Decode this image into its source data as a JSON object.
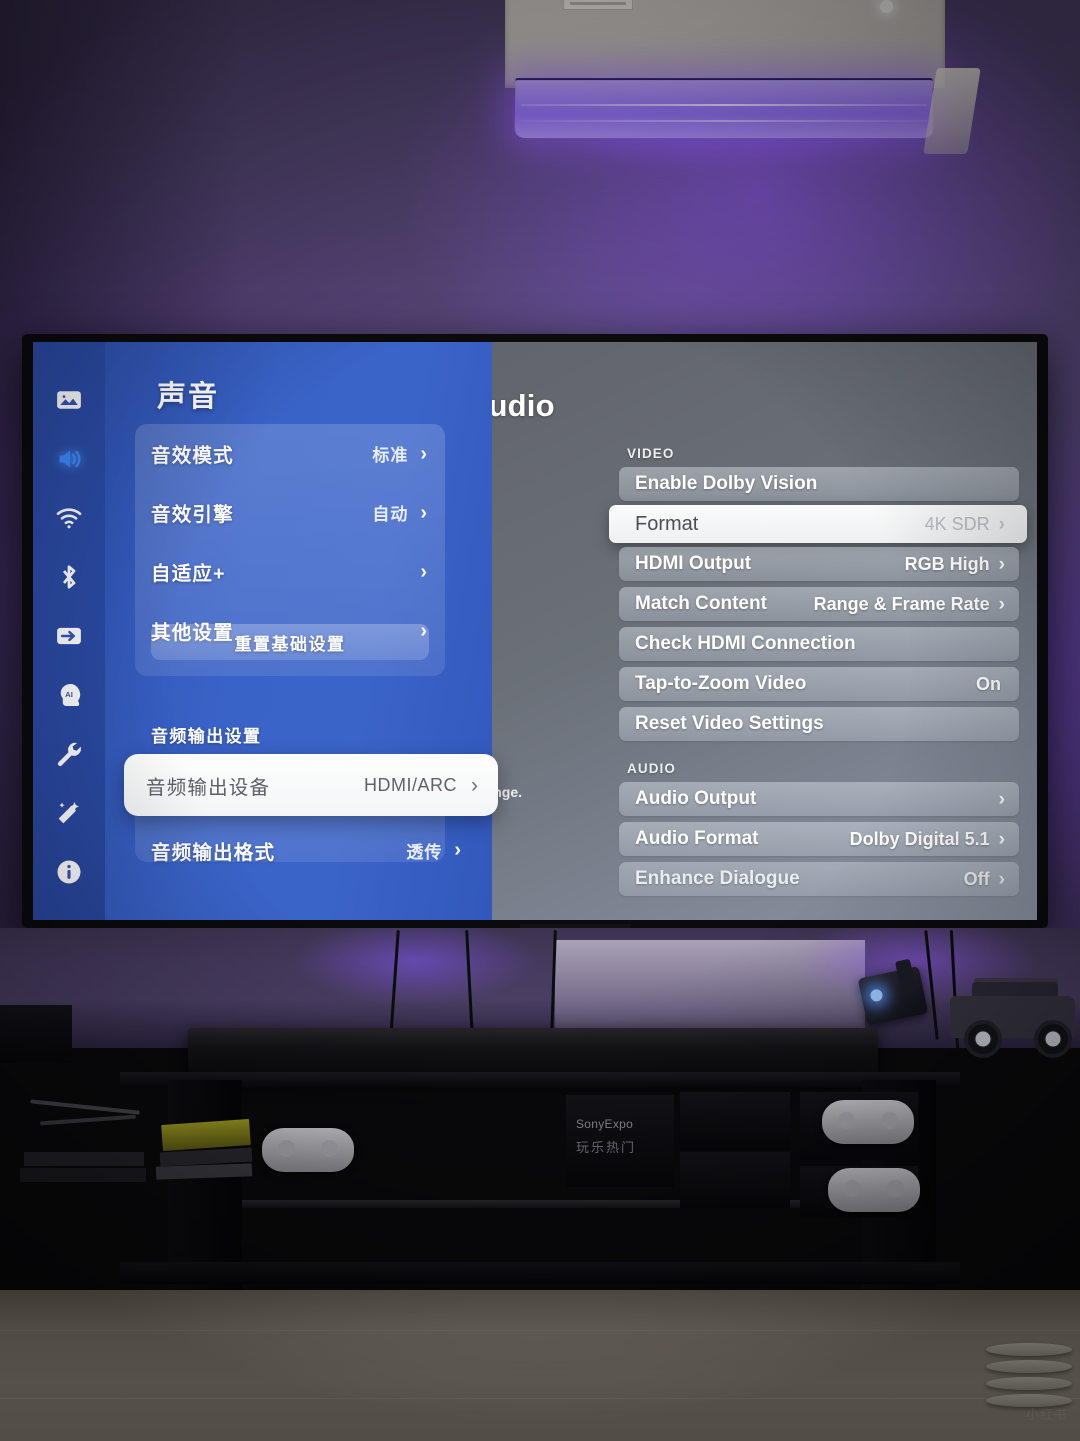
{
  "room": {
    "appliance": "air-conditioner",
    "av_unit_brand": "SonyExpo",
    "av_unit_brand_zh": "玩乐热门"
  },
  "tv_ui": {
    "appletv": {
      "title": "deo and Audio",
      "stray_text": "range.",
      "sections": [
        {
          "label": "VIDEO",
          "rows": [
            {
              "label": "Enable Dolby Vision",
              "value": "",
              "chevron": false,
              "selected": false
            },
            {
              "label": "Format",
              "value": "4K SDR",
              "chevron": true,
              "selected": true
            },
            {
              "label": "HDMI Output",
              "value": "RGB High",
              "chevron": true,
              "selected": false
            },
            {
              "label": "Match Content",
              "value": "Range & Frame Rate",
              "chevron": true,
              "selected": false
            },
            {
              "label": "Check HDMI Connection",
              "value": "",
              "chevron": false,
              "selected": false
            },
            {
              "label": "Tap-to-Zoom Video",
              "value": "On",
              "chevron": false,
              "selected": false
            },
            {
              "label": "Reset Video Settings",
              "value": "",
              "chevron": false,
              "selected": false
            }
          ]
        },
        {
          "label": "AUDIO",
          "rows": [
            {
              "label": "Audio Output",
              "value": "",
              "chevron": true,
              "selected": false
            },
            {
              "label": "Audio Format",
              "value": "Dolby Digital 5.1",
              "chevron": true,
              "selected": false
            },
            {
              "label": "Enhance Dialogue",
              "value": "Off",
              "chevron": true,
              "selected": false
            }
          ]
        }
      ]
    },
    "sound_panel": {
      "title": "声音",
      "icons": [
        {
          "name": "picture-icon",
          "label": "画面",
          "active": false
        },
        {
          "name": "sound-icon",
          "label": "声音",
          "active": true
        },
        {
          "name": "wifi-icon",
          "label": "网络",
          "active": false
        },
        {
          "name": "bluetooth-icon",
          "label": "蓝牙",
          "active": false
        },
        {
          "name": "input-source-icon",
          "label": "信号源",
          "active": false
        },
        {
          "name": "ai-head-icon",
          "label": "AI",
          "active": false
        },
        {
          "name": "wrench-icon",
          "label": "系统",
          "active": false
        },
        {
          "name": "magic-wand-icon",
          "label": "工具",
          "active": false
        },
        {
          "name": "info-icon",
          "label": "关于",
          "active": false
        }
      ],
      "rows": [
        {
          "label": "音效模式",
          "value": "标准",
          "chevron": true
        },
        {
          "label": "音效引擎",
          "value": "自动",
          "chevron": true
        },
        {
          "label": "自适应+",
          "value": "",
          "chevron": true
        },
        {
          "label": "其他设置",
          "value": "",
          "chevron": true
        }
      ],
      "reset_button": "重置基础设置",
      "group_label": "音频输出设置",
      "output_device": {
        "label": "音频输出设备",
        "value": "HDMI/ARC",
        "chevron": true,
        "selected": true
      },
      "output_format": {
        "label": "音频输出格式",
        "value": "透传",
        "chevron": true,
        "selected": false
      }
    }
  },
  "colors": {
    "panel_blue": "#3a63c7",
    "icon_bar_blue": "#2c4da8",
    "accent_selected": "#ffffff",
    "wall_purple": "#5a4a7d",
    "led_purple": "#8f6ff0"
  }
}
